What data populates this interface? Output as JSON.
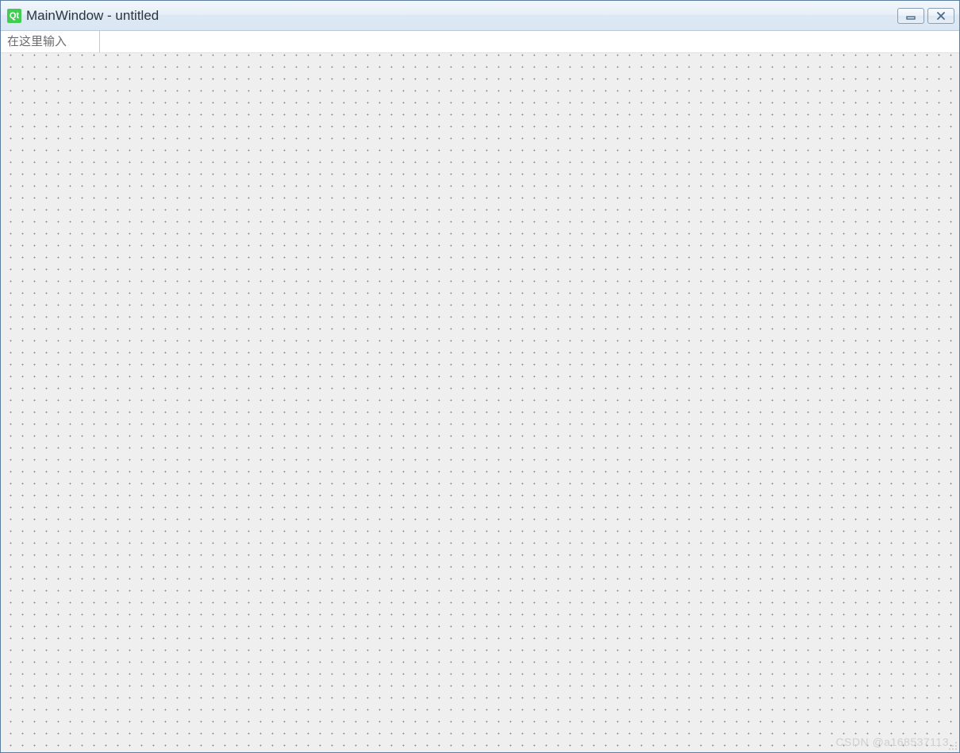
{
  "window": {
    "icon_label": "Qt",
    "title": "MainWindow - untitled"
  },
  "menubar": {
    "placeholder": "在这里输入"
  },
  "watermark": "CSDN @a168537113"
}
